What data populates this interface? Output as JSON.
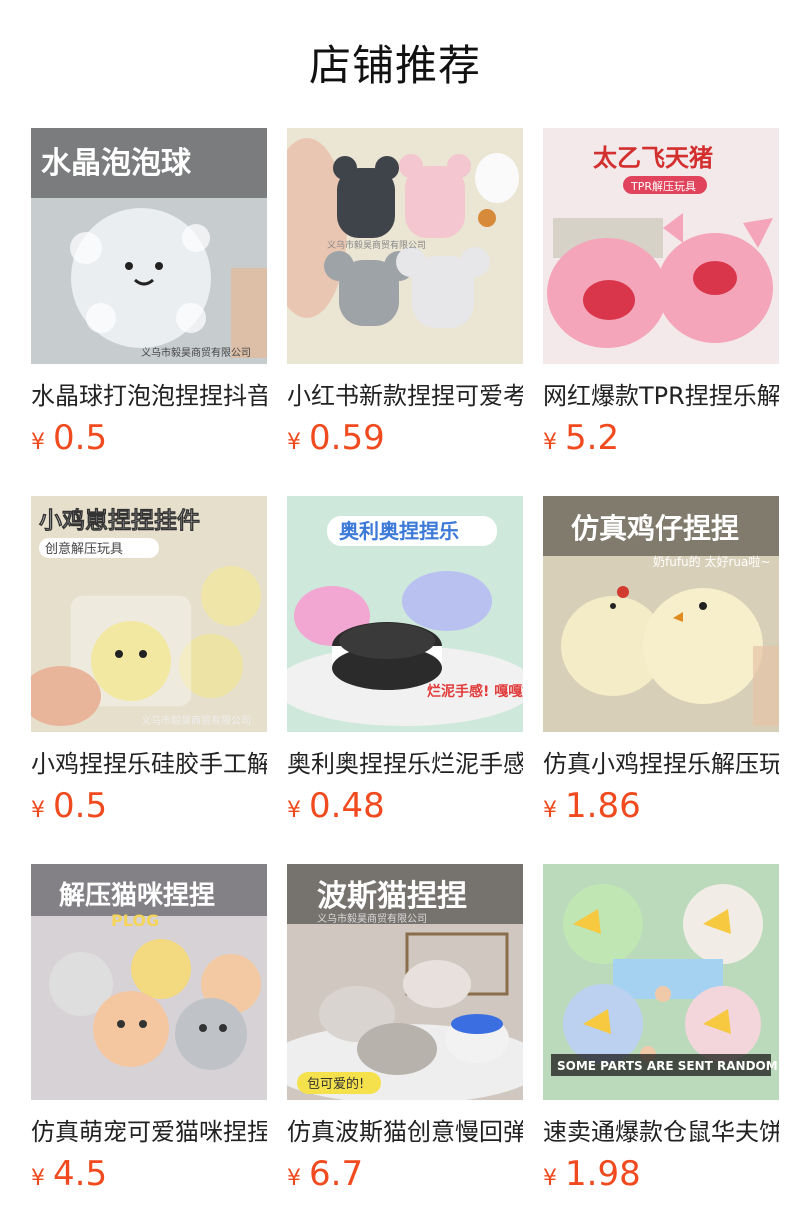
{
  "section": {
    "title": "店铺推荐"
  },
  "products": [
    {
      "name": "水晶球打泡泡捏捏抖音同款",
      "currency": "¥",
      "price": "0.5",
      "banner": "水晶泡泡球",
      "subtext": "",
      "watermark": "义乌市毅昊商贸有限公司",
      "theme": "#cfd4d8",
      "icon": "bubble-ball-icon"
    },
    {
      "name": "小红书新款捏捏可爱考拉小熊",
      "currency": "¥",
      "price": "0.59",
      "banner": "",
      "subtext": "",
      "watermark": "义乌市毅昊商贸有限公司",
      "theme": "#ece6d6",
      "icon": "bear-koala-icon"
    },
    {
      "name": "网红爆款TPR捏捏乐解压玩具",
      "currency": "¥",
      "price": "5.2",
      "banner": "太乙飞天猪",
      "subtext": "TPR解压玩具",
      "watermark": "",
      "theme": "#f6c7cf",
      "icon": "pig-icon"
    },
    {
      "name": "小鸡捏捏乐硅胶手工解压玩具",
      "currency": "¥",
      "price": "0.5",
      "banner": "小鸡崽捏捏挂件",
      "subtext": "创意解压玩具",
      "watermark": "义乌市毅昊商贸有限公司",
      "theme": "#e8e2cf",
      "icon": "chick-icon"
    },
    {
      "name": "奥利奥捏捏乐烂泥手感解压",
      "currency": "¥",
      "price": "0.48",
      "banner": "奥利奥捏捏乐",
      "subtext": "烂泥手感! 嘎嘎好捏!",
      "watermark": "",
      "theme": "#c9e6d8",
      "icon": "oreo-icon"
    },
    {
      "name": "仿真小鸡捏捏乐解压玩具",
      "currency": "¥",
      "price": "1.86",
      "banner": "仿真鸡仔捏捏",
      "subtext": "奶fufu的 太好rua啦~",
      "watermark": "",
      "theme": "#d8cfb8",
      "icon": "chick-icon"
    },
    {
      "name": "仿真萌宠可爱猫咪捏捏乐",
      "currency": "¥",
      "price": "4.5",
      "banner": "解压猫咪捏捏",
      "subtext": "PLOG",
      "watermark": "",
      "theme": "#d9d3d7",
      "icon": "cat-icon"
    },
    {
      "name": "仿真波斯猫创意慢回弹解压",
      "currency": "¥",
      "price": "6.7",
      "banner": "波斯猫捏捏",
      "subtext": "包可爱的!",
      "watermark": "义乌市毅昊商贸有限公司",
      "theme": "#d6cfc8",
      "icon": "persian-cat-icon"
    },
    {
      "name": "速卖通爆款仓鼠华夫饼捏捏",
      "currency": "¥",
      "price": "1.98",
      "banner": "",
      "subtext": "SOME PARTS ARE SENT RANDOM",
      "watermark": "",
      "theme": "#c8e0c8",
      "icon": "hamster-icon"
    }
  ]
}
